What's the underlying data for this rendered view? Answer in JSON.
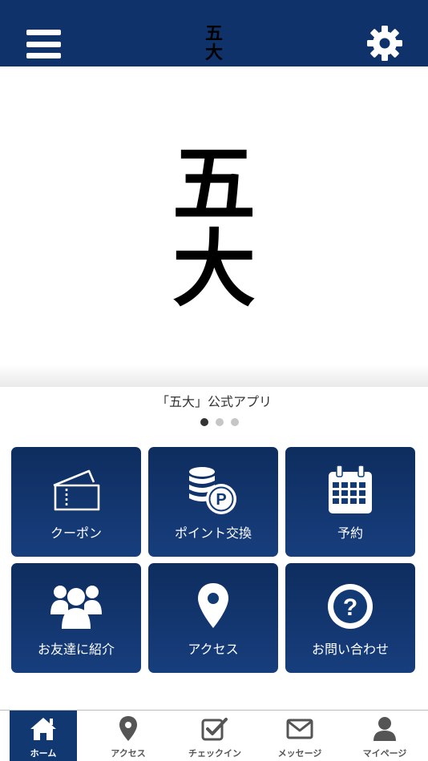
{
  "header": {
    "logo_top": "五",
    "logo_bottom": "大",
    "menu_icon": "hamburger-icon",
    "settings_icon": "gear-icon",
    "color": "#0f326a"
  },
  "hero": {
    "logo_top": "五",
    "logo_bottom": "大"
  },
  "caption": "「五大」公式アプリ",
  "carousel": {
    "count": 3,
    "active": 1
  },
  "tiles": [
    {
      "label": "クーポン",
      "icon": "ticket-icon"
    },
    {
      "label": "ポイント交換",
      "icon": "coins-icon"
    },
    {
      "label": "予約",
      "icon": "calendar-icon"
    },
    {
      "label": "お友達に紹介",
      "icon": "users-icon"
    },
    {
      "label": "アクセス",
      "icon": "map-pin-icon"
    },
    {
      "label": "お問い合わせ",
      "icon": "question-icon"
    }
  ],
  "tabs": [
    {
      "label": "ホーム",
      "icon": "home-icon",
      "active": true
    },
    {
      "label": "アクセス",
      "icon": "map-pin-icon",
      "active": false
    },
    {
      "label": "チェックイン",
      "icon": "checkin-icon",
      "active": false
    },
    {
      "label": "メッセージ",
      "icon": "envelope-icon",
      "active": false
    },
    {
      "label": "マイページ",
      "icon": "user-icon",
      "active": false
    }
  ],
  "colors": {
    "accent": "#0f326a",
    "tile_top": "#0e2d5f",
    "tile_bottom": "#173e7d",
    "tab_inactive": "#555555"
  }
}
